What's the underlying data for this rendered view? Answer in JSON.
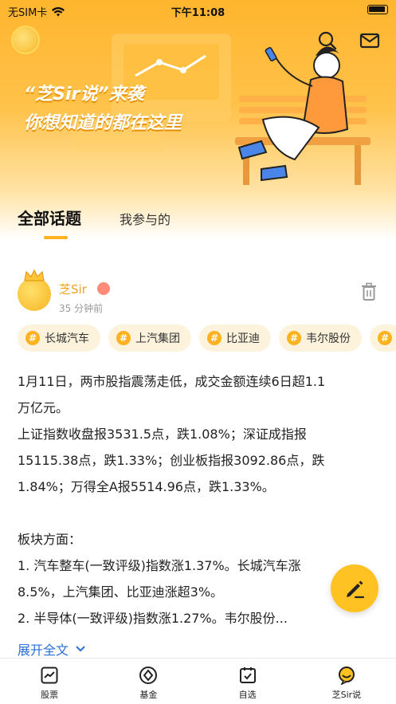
{
  "status_bar": {
    "carrier": "无SIM卡",
    "time": "下午11:08"
  },
  "banner": {
    "title": "“芝Sir说”来袭",
    "subtitle": "你想知道的都在这里"
  },
  "tabs": [
    {
      "label": "全部话题",
      "active": true
    },
    {
      "label": "我参与的",
      "active": false
    }
  ],
  "post": {
    "author": "芝Sir",
    "time": "35 分钟前",
    "tags": [
      "长城汽车",
      "上汽集团",
      "比亚迪",
      "韦尔股份"
    ],
    "lines": [
      "1月11日，两市股指震荡走低，成交金额连续6日超1.1",
      "万亿元。",
      "上证指数收盘报3531.5点，跌1.08%；深证成指报",
      "15115.38点，跌1.33%；创业板指报3092.86点，跌",
      "1.84%；万得全A报5514.96点，跌1.33%。",
      "",
      "板块方面：",
      "1. 汽车整车(一致评级)指数涨1.37%。长城汽车涨",
      "8.5%，上汽集团、比亚迪涨超3%。",
      "2. 半导体(一致评级)指数涨1.27%。韦尔股份..."
    ],
    "expand_label": "展开全文"
  },
  "tabbar": [
    {
      "label": "股票",
      "icon": "chart-icon"
    },
    {
      "label": "基金",
      "icon": "fund-icon"
    },
    {
      "label": "自选",
      "icon": "calendar-check-icon"
    },
    {
      "label": "芝Sir说",
      "icon": "chat-icon"
    }
  ],
  "colors": {
    "accent": "#ffb21f",
    "link": "#2b6fd6",
    "author": "#f0a11d"
  }
}
